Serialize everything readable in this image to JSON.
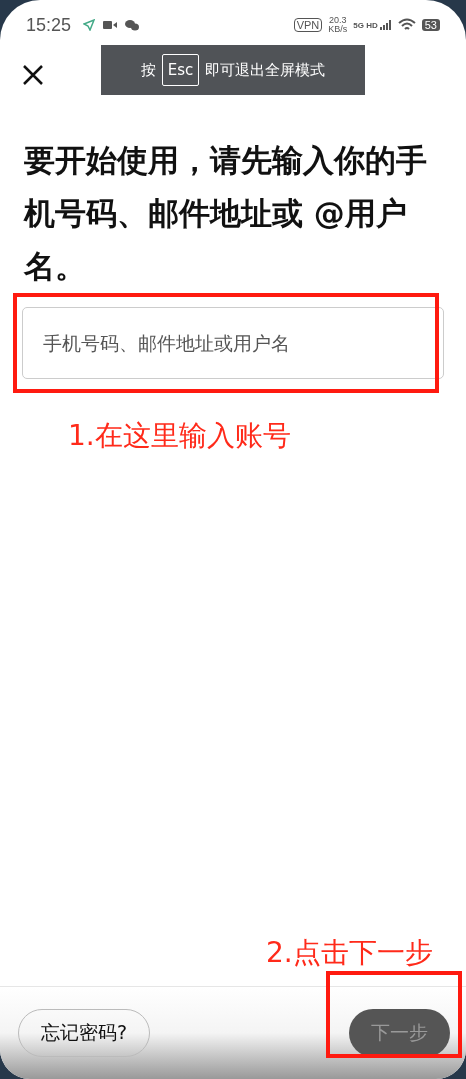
{
  "status_bar": {
    "time": "15:25",
    "vpn": "VPN",
    "speed": "20.3",
    "speed_unit": "KB/s",
    "network": "5G HD",
    "battery": "53"
  },
  "fullscreen_toast": {
    "prefix": "按",
    "key": "Esc",
    "suffix": "即可退出全屏模式"
  },
  "heading": "要开始使用，请先输入你的手机号码、邮件地址或 @用户名。",
  "account_field": {
    "placeholder": "手机号码、邮件地址或用户名"
  },
  "annotations": [
    {
      "text": "1.在这里输入账号"
    },
    {
      "text": "2.点击下一步"
    }
  ],
  "bottom_bar": {
    "forgot_button": "忘记密码?",
    "next_button": {
      "label": "下一步",
      "disabled": true
    }
  }
}
